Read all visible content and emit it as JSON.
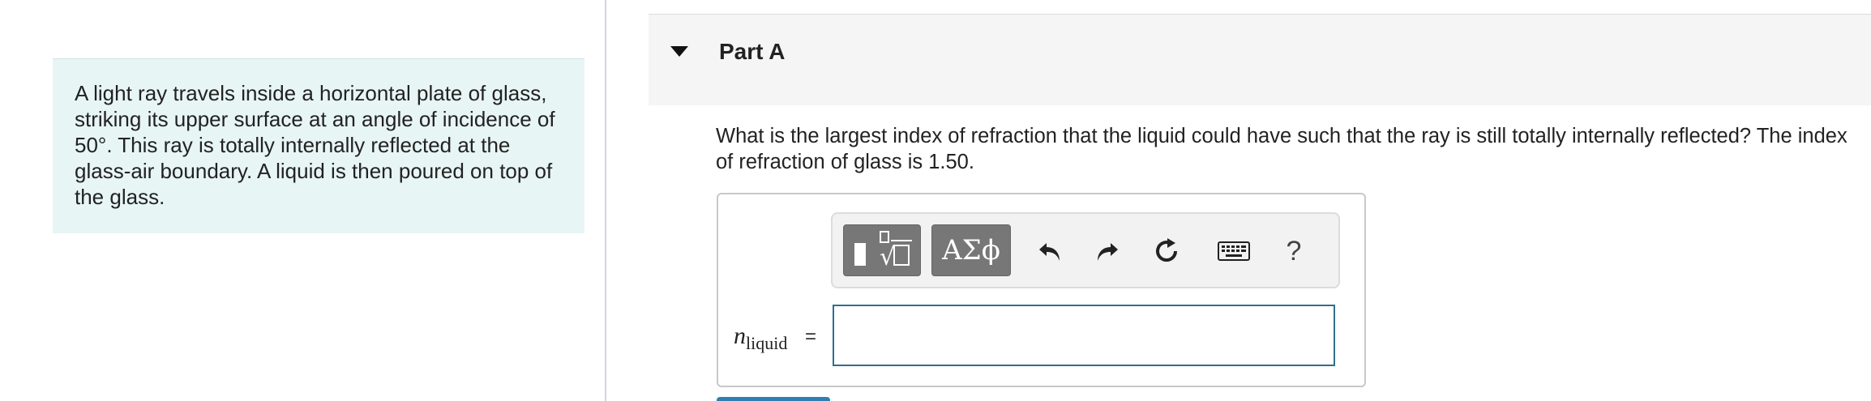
{
  "problem": {
    "intro_text": "A light ray travels inside a horizontal plate of glass, striking its upper surface at an angle of incidence of 50°. This ray is totally internally reflected at the glass-air boundary. A liquid is then poured on top of the glass."
  },
  "part": {
    "title": "Part A",
    "question": "What is the largest index of refraction that the liquid could have such that the ray is still totally internally reflected? The index of refraction of glass is 1.50."
  },
  "toolbar": {
    "symbols_label": "ΑΣϕ",
    "help_label": "?",
    "icons": [
      "templates-icon",
      "undo-icon",
      "redo-icon",
      "reset-icon",
      "keyboard-icon",
      "help-icon"
    ]
  },
  "answer": {
    "var_main": "n",
    "var_sub": "liquid",
    "equals": "=",
    "value": ""
  },
  "colors": {
    "intro_bg": "#e8f5f5",
    "header_bg": "#f5f5f5",
    "toolbar_button": "#777777",
    "input_border": "#2f6f8f",
    "submit": "#2f7fb5"
  }
}
